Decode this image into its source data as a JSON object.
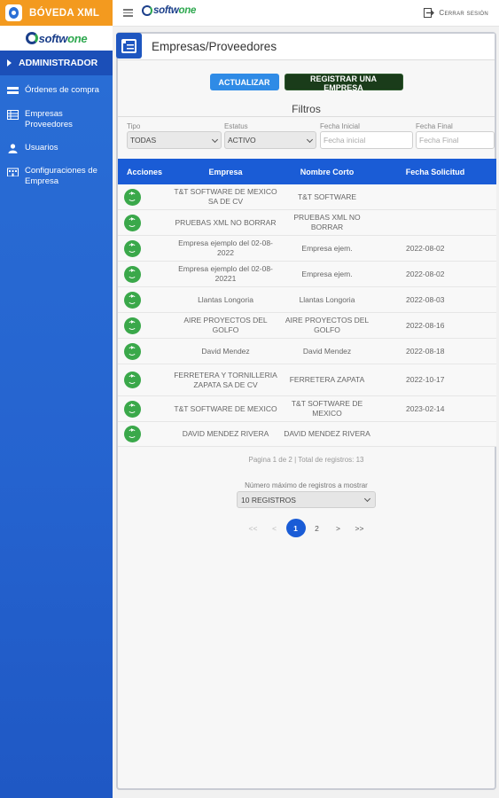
{
  "app": {
    "title": "BÓVEDA XML",
    "brand_color": "#f39a1f",
    "logo_text_a": "soft",
    "logo_text_b": "one"
  },
  "sidebar": {
    "section": "ADMINISTRADOR",
    "items": [
      {
        "label": "Órdenes de compra",
        "icon": "cards-icon"
      },
      {
        "label": "Empresas Proveedores",
        "icon": "table-icon"
      },
      {
        "label": "Usuarios",
        "icon": "user-icon"
      },
      {
        "label": "Configuraciones de Empresa",
        "icon": "building-icon"
      }
    ]
  },
  "topbar": {
    "logout_label": "Cerrar sesión"
  },
  "page": {
    "title": "Empresas/Proveedores",
    "update_label": "ACTUALIZAR",
    "register_label": "REGISTRAR UNA EMPRESA",
    "filters_title": "Filtros"
  },
  "filters": {
    "tipo_label": "Tipo",
    "tipo_value": "TODAS",
    "estatus_label": "Estatus",
    "estatus_value": "ACTIVO",
    "fecha_inicial_label": "Fecha Inicial",
    "fecha_inicial_placeholder": "Fecha inicial",
    "fecha_final_label": "Fecha Final",
    "fecha_final_placeholder": "Fecha Final"
  },
  "table": {
    "headers": [
      "Acciones",
      "Empresa",
      "Nombre Corto",
      "Fecha Solicitud"
    ],
    "rows": [
      {
        "empresa": "T&T SOFTWARE DE MEXICO SA DE CV",
        "corto": "T&T SOFTWARE",
        "fecha": ""
      },
      {
        "empresa": "PRUEBAS XML NO BORRAR",
        "corto": "PRUEBAS XML NO BORRAR",
        "fecha": ""
      },
      {
        "empresa": "Empresa ejemplo del 02-08-2022",
        "corto": "Empresa ejem.",
        "fecha": "2022-08-02"
      },
      {
        "empresa": "Empresa ejemplo del 02-08-20221",
        "corto": "Empresa ejem.",
        "fecha": "2022-08-02"
      },
      {
        "empresa": "Llantas Longoria",
        "corto": "Llantas Longoria",
        "fecha": "2022-08-03"
      },
      {
        "empresa": "AIRE PROYECTOS DEL GOLFO",
        "corto": "AIRE PROYECTOS DEL GOLFO",
        "fecha": "2022-08-16"
      },
      {
        "empresa": "David Mendez",
        "corto": "David Mendez",
        "fecha": "2022-08-18"
      },
      {
        "empresa": "FERRETERA Y TORNILLERIA ZAPATA SA DE CV",
        "corto": "FERRETERA ZAPATA",
        "fecha": "2022-10-17"
      },
      {
        "empresa": "T&T SOFTWARE DE MEXICO",
        "corto": "T&T SOFTWARE DE MEXICO",
        "fecha": "2023-02-14"
      },
      {
        "empresa": "DAVID MENDEZ RIVERA",
        "corto": "DAVID MENDEZ RIVERA",
        "fecha": ""
      }
    ]
  },
  "pagination": {
    "info": "Pagina 1 de 2 | Total de registros: 13",
    "max_label": "Número máximo de registros a mostrar",
    "max_value": "10 REGISTROS",
    "first": "<<",
    "prev": "<",
    "pages": [
      "1",
      "2"
    ],
    "next": ">",
    "last": ">>"
  }
}
